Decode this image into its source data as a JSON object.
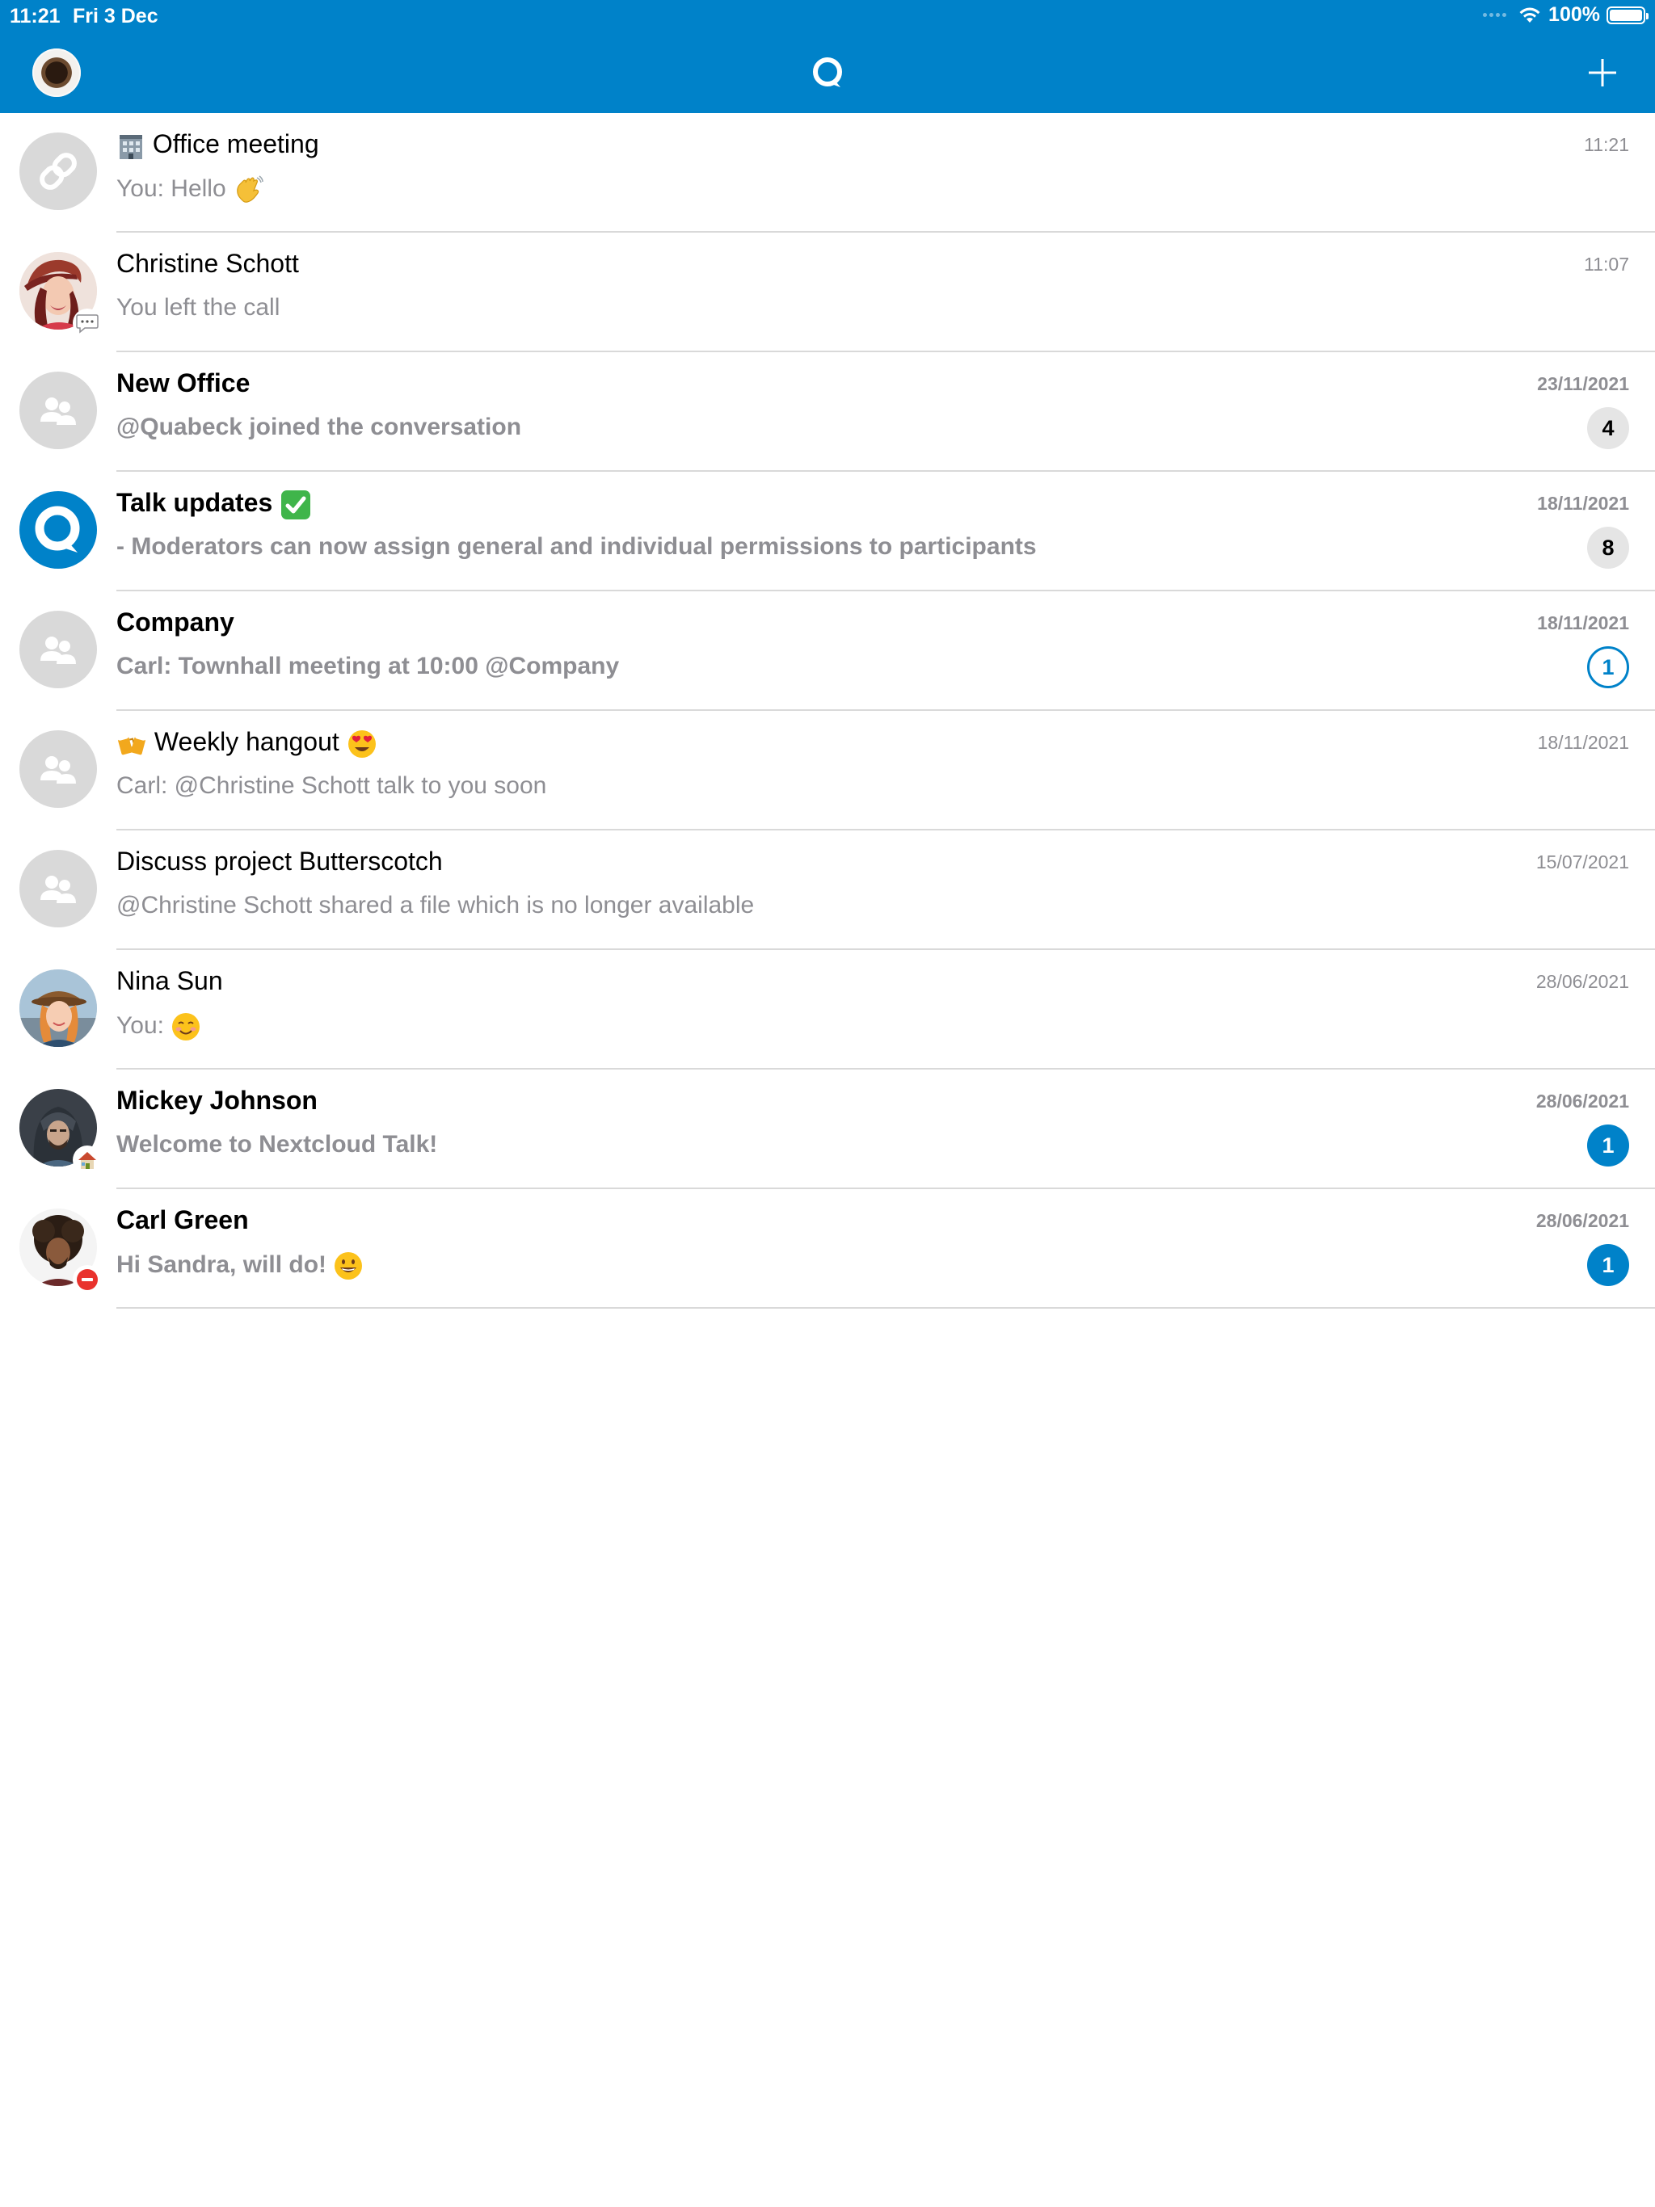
{
  "status_bar": {
    "time": "11:21",
    "date": "Fri 3 Dec",
    "battery": "100%"
  },
  "nav": {
    "avatar_icon": "coffee-avatar",
    "logo_icon": "talk-logo-icon",
    "add_icon": "plus-icon"
  },
  "colors": {
    "brand": "#0082c9",
    "secondary_text": "#8e8e93",
    "divider": "#d9d9d9"
  },
  "conversations": [
    {
      "title": "Office meeting",
      "title_emoji": "office-building-emoji",
      "subtitle": "You: Hello",
      "subtitle_emoji": "waving-hand-emoji",
      "time": "11:21",
      "avatar": "link-icon",
      "unread": ""
    },
    {
      "title": "Christine Schott",
      "subtitle": "You left the call",
      "time": "11:07",
      "avatar": "photo-christine",
      "status": "speech-bubble-status-icon",
      "unread": ""
    },
    {
      "title": "New Office",
      "subtitle": "@Quabeck joined the conversation",
      "time": "23/11/2021",
      "avatar": "group-icon",
      "unread": "4"
    },
    {
      "title": "Talk updates",
      "title_emoji": "check-mark-emoji",
      "subtitle": "- Moderators can now assign general and individual permissions to participants",
      "time": "18/11/2021",
      "avatar": "talk-logo-icon",
      "unread": "8"
    },
    {
      "title": "Company",
      "subtitle": "Carl: Townhall meeting at 10:00 @Company",
      "time": "18/11/2021",
      "avatar": "group-icon",
      "unread": "1"
    },
    {
      "title": "Weekly hangout",
      "title_emoji_before": "beer-mugs-emoji",
      "title_emoji": "heart-eyes-emoji",
      "subtitle": "Carl: @Christine Schott talk to you soon",
      "time": "18/11/2021",
      "avatar": "group-icon",
      "unread": ""
    },
    {
      "title": "Discuss project Butterscotch",
      "subtitle": "@Christine Schott shared a file which is no longer available",
      "time": "15/07/2021",
      "avatar": "group-icon",
      "unread": ""
    },
    {
      "title": "Nina Sun",
      "subtitle": "You:",
      "subtitle_emoji": "smiling-face-emoji",
      "time": "28/06/2021",
      "avatar": "photo-nina",
      "unread": ""
    },
    {
      "title": "Mickey Johnson",
      "subtitle": "Welcome to Nextcloud Talk!",
      "time": "28/06/2021",
      "avatar": "photo-mickey",
      "status": "house-status-icon",
      "unread": "1"
    },
    {
      "title": "Carl Green",
      "subtitle": "Hi Sandra, will do!",
      "subtitle_emoji": "grinning-face-emoji",
      "time": "28/06/2021",
      "avatar": "photo-carl",
      "status": "do-not-disturb-status-icon",
      "unread": "1"
    }
  ]
}
